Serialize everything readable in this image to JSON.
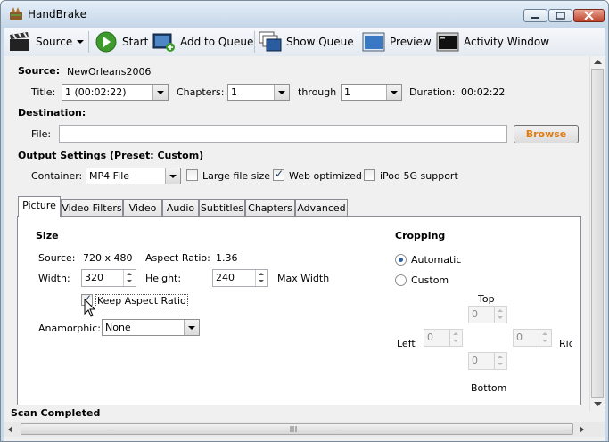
{
  "window": {
    "title": "HandBrake"
  },
  "toolbar": {
    "source": "Source",
    "start": "Start",
    "add_to_queue": "Add to Queue",
    "show_queue": "Show Queue",
    "preview": "Preview",
    "activity_window": "Activity Window"
  },
  "source": {
    "label": "Source:",
    "value": "NewOrleans2006",
    "title_label": "Title:",
    "title_value": "1 (00:02:22)",
    "chapters_label": "Chapters:",
    "chapter_start": "1",
    "through_label": "through",
    "chapter_end": "1",
    "duration_label": "Duration:",
    "duration_value": "00:02:22"
  },
  "destination": {
    "label": "Destination:",
    "file_label": "File:",
    "file_value": "",
    "browse": "Browse"
  },
  "output": {
    "label": "Output Settings (Preset: Custom)",
    "container_label": "Container:",
    "container_value": "MP4 File",
    "large_file": "Large file size",
    "large_file_checked": false,
    "web_optimized": "Web optimized",
    "web_optimized_checked": true,
    "ipod": "iPod 5G support",
    "ipod_checked": false
  },
  "tabs": [
    "Picture",
    "Video Filters",
    "Video",
    "Audio",
    "Subtitles",
    "Chapters",
    "Advanced"
  ],
  "active_tab": "Picture",
  "picture": {
    "size_heading": "Size",
    "source_label": "Source:",
    "source_value": "720 x 480",
    "aspect_label": "Aspect Ratio:",
    "aspect_value": "1.36",
    "width_label": "Width:",
    "width_value": "320",
    "height_label": "Height:",
    "height_value": "240",
    "max_width": "Max Width",
    "keep_aspect": "Keep Aspect Ratio",
    "keep_aspect_checked": true,
    "anamorphic_label": "Anamorphic:",
    "anamorphic_value": "None"
  },
  "cropping": {
    "heading": "Cropping",
    "automatic": "Automatic",
    "custom": "Custom",
    "selected": "Automatic",
    "top_label": "Top",
    "left_label": "Left",
    "right_label": "Rig",
    "bottom_label": "Bottom",
    "top_value": "0",
    "left_value": "0",
    "right_value": "0",
    "bottom_value": "0"
  },
  "status": {
    "text": "Scan Completed"
  }
}
